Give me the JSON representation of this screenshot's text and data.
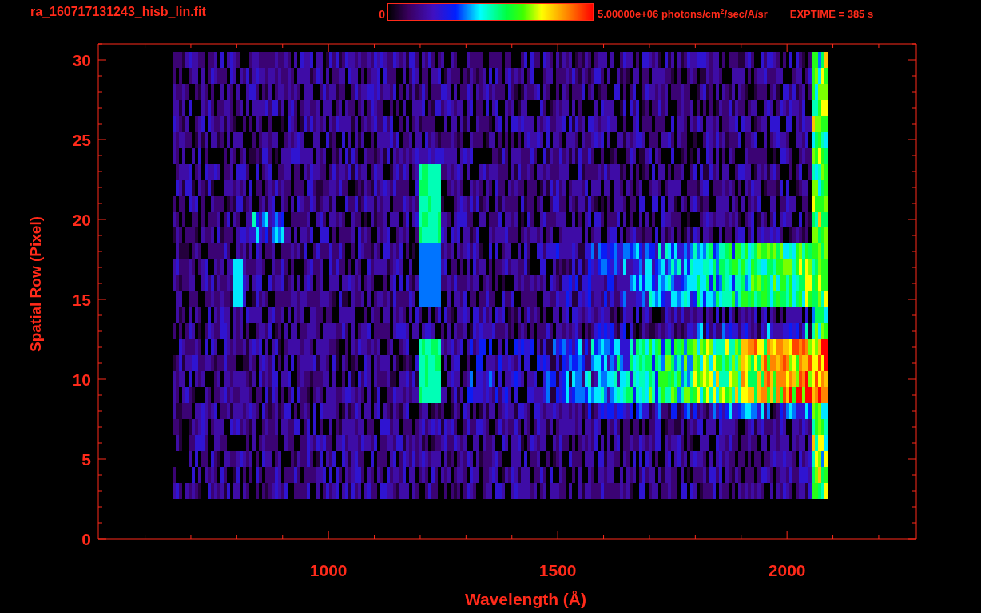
{
  "title": "ra_160717131243_hisb_lin.fit",
  "colorbar": {
    "min_label": "0",
    "max_label": "5.00000e+06 photons/cm$^{2}$/sec/A/sr"
  },
  "exposure": "EXPTIME = 385 s",
  "plot": {
    "xlabel": "Wavelength (Å)",
    "ylabel": "Spatial Row (Pixel)",
    "xticks": [
      "1000",
      "1500",
      "2000"
    ],
    "yticks": [
      "30",
      "25",
      "20",
      "15",
      "10",
      "5",
      "0"
    ]
  }
}
